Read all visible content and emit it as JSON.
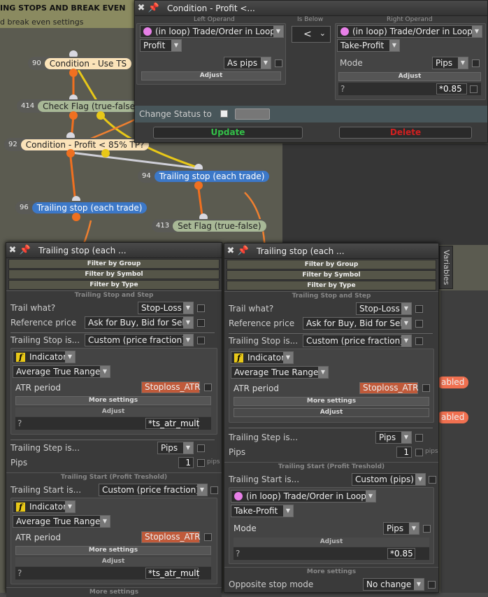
{
  "canvas": {
    "title": "ING STOPS AND BREAK EVEN",
    "subtitle": "d break even settings",
    "nodes": [
      {
        "id": "90",
        "label": "Condition - Use TS"
      },
      {
        "id": "414",
        "label": "Check Flag (true-false)"
      },
      {
        "id": "92",
        "label": "Condition - Profit < 85% TP?"
      },
      {
        "id": "94",
        "label": "Trailing stop (each trade)"
      },
      {
        "id": "96",
        "label": "Trailing stop (each trade)"
      },
      {
        "id": "413",
        "label": "Set Flag (true-false)"
      }
    ],
    "side_pills": [
      "abled",
      "abled"
    ],
    "variables_tab": "Variables"
  },
  "condition_window": {
    "title": "Condition - Profit <...",
    "left_operand_header": "Left Operand",
    "is_below_header": "Is Below",
    "right_operand_header": "Right Operand",
    "left": {
      "source": "(in loop) Trade/Order in Loop",
      "field": "Profit",
      "unit": "As pips",
      "adjust": "Adjust"
    },
    "operator": "<",
    "right": {
      "source": "(in loop) Trade/Order in Loop",
      "field": "Take-Profit",
      "mode_label": "Mode",
      "mode": "Pips",
      "adjust": "Adjust",
      "adjust_var": "?",
      "adjust_val": "*0.85"
    },
    "change_status": "Change Status to",
    "update": "Update",
    "delete": "Delete"
  },
  "trail_left": {
    "title": "Trailing stop (each ...",
    "filters": [
      "Filter by Group",
      "Filter by Symbol",
      "Filter by Type"
    ],
    "section1": "Trailing Stop and Step",
    "trail_what_label": "Trail what?",
    "trail_what": "Stop-Loss",
    "ref_label": "Reference price",
    "ref": "Ask for Buy, Bid for Sell",
    "ts_is_label": "Trailing Stop is...",
    "ts_is": "Custom (price fraction)",
    "indicator": "Indicator",
    "indicator_name": "Average True Range",
    "atr_label": "ATR period",
    "atr_val": "Stoploss_ATR",
    "more": "More settings",
    "adjust": "Adjust",
    "adj_var": "?",
    "adj_val": "*ts_atr_mult",
    "step_label": "Trailing Step is...",
    "step": "Pips",
    "pips_label": "Pips",
    "pips_val": "1",
    "pips_unit": "pips",
    "section2": "Trailing Start (Profit Treshold)",
    "start_label": "Trailing Start is...",
    "start": "Custom (price fraction)",
    "indicator2": "Indicator",
    "indicator_name2": "Average True Range",
    "atr_label2": "ATR period",
    "atr_val2": "Stoploss_ATR",
    "more2": "More settings",
    "adjust2": "Adjust",
    "adj_var2": "?",
    "adj_val2": "*ts_atr_mult",
    "more3": "More settings"
  },
  "trail_right": {
    "title": "Trailing stop (each ...",
    "filters": [
      "Filter by Group",
      "Filter by Symbol",
      "Filter by Type"
    ],
    "section1": "Trailing Stop and Step",
    "trail_what_label": "Trail what?",
    "trail_what": "Stop-Loss",
    "ref_label": "Reference price",
    "ref": "Ask for Buy, Bid for Sell",
    "ts_is_label": "Trailing Stop is...",
    "ts_is": "Custom (price fraction)",
    "indicator": "Indicator",
    "indicator_name": "Average True Range",
    "atr_label": "ATR period",
    "atr_val": "Stoploss_ATR",
    "more": "More settings",
    "adjust": "Adjust",
    "step_label": "Trailing Step is...",
    "step": "Pips",
    "pips_label": "Pips",
    "pips_val": "1",
    "pips_unit": "pips",
    "section2": "Trailing Start (Profit Treshold)",
    "start_label": "Trailing Start is...",
    "start": "Custom (pips)",
    "source": "(in loop) Trade/Order in Loop",
    "field": "Take-Profit",
    "mode_label": "Mode",
    "mode": "Pips",
    "adjust2": "Adjust",
    "adj_var2": "?",
    "adj_val2": "*0.85",
    "more3": "More settings",
    "opp_label": "Opposite stop mode",
    "opp": "No change"
  }
}
